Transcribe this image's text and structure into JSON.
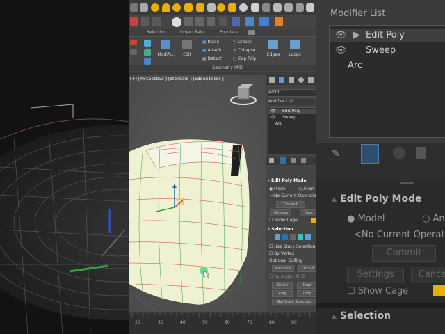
{
  "ribbon": {
    "tabs": [
      "Selection",
      "Object Paint",
      "Populate"
    ],
    "buttons": {
      "modify": "Modify...",
      "edit": "Edit",
      "relax": "Relax",
      "attach": "Attach",
      "detach": "Detach",
      "create": "Create",
      "collapse": "Collapse",
      "cap_poly": "Cap Poly",
      "edges": "Edges",
      "loops": "Loops"
    },
    "group_label": "Geometry (All)"
  },
  "viewport": {
    "label": "[+] [Perspective ] [Standard ] [Edged Faces ]"
  },
  "command_panel": {
    "object_name": "Arc001",
    "modifier_list_label": "Modifier List",
    "stack": [
      "Edit Poly",
      "Sweep",
      "Arc"
    ],
    "edit_poly_mode": {
      "title": "Edit Poly Mode",
      "model_label": "Model",
      "animate_label": "Anim",
      "current_op": "<No Current Operatio",
      "commit": "Commit",
      "settings": "Settings",
      "cancel": "Canc",
      "show_cage": "Show Cage"
    },
    "selection": {
      "title": "Selection",
      "use_stack": "Use Stack Selection",
      "by_vertex": "By Vertex",
      "optional_culling": "Optional Culling",
      "backface": "Backface",
      "occlude": "Occlud",
      "by_angle": "By Angle:",
      "angle_value": "45.0",
      "shrink": "Shrink",
      "grow": "Grow",
      "ring": "Ring",
      "loop": "Loop",
      "get_stack": "Get Stack Selection"
    }
  },
  "ruler": {
    "ticks": [
      "20",
      "30",
      "40",
      "50",
      "60",
      "70",
      "80",
      "90"
    ]
  },
  "zoom_panel": {
    "modifier_list": "Modifier List",
    "stack": [
      "Edit Poly",
      "Sweep",
      "Arc"
    ],
    "edit_poly_mode": "Edit Poly Mode",
    "model": "Model",
    "anim": "Anim",
    "current_op": "<No Current Operatio",
    "commit": "Commit",
    "settings": "Settings",
    "cancel": "Cance",
    "show_cage": "Show Cage",
    "selection": "Selection"
  },
  "colors": {
    "mesh_fill": "#eef2d2",
    "wire_red": "#d04040",
    "wire_green": "#3a9a4a",
    "accent_blue": "#2f6fa5",
    "swatch_yellow": "#e8b000"
  }
}
